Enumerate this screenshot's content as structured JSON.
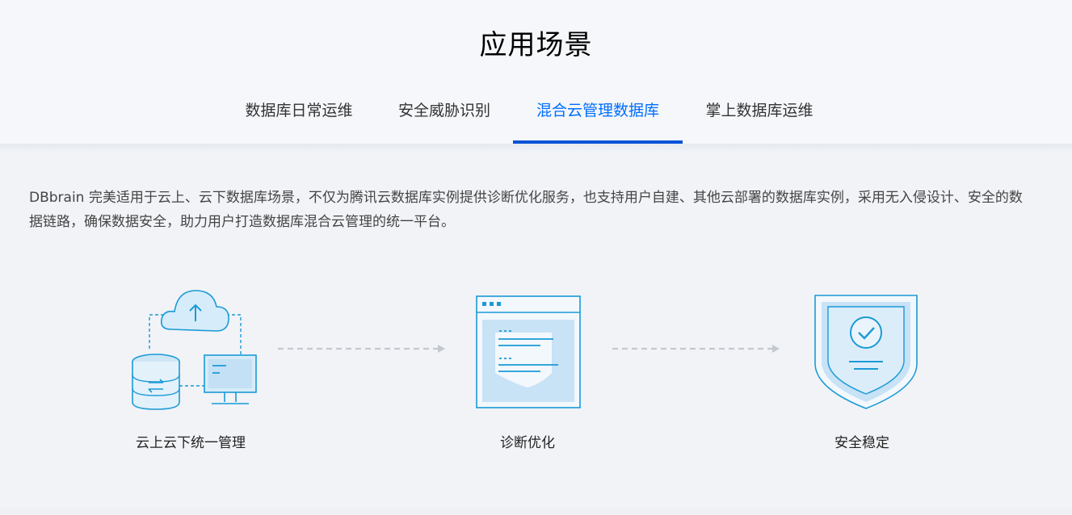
{
  "section": {
    "title": "应用场景"
  },
  "tabs": [
    {
      "label": "数据库日常运维",
      "active": false
    },
    {
      "label": "安全威胁识别",
      "active": false
    },
    {
      "label": "混合云管理数据库",
      "active": true
    },
    {
      "label": "掌上数据库运维",
      "active": false
    }
  ],
  "content": {
    "description": "DBbrain 完美适用于云上、云下数据库场景，不仅为腾讯云数据库实例提供诊断优化服务，也支持用户自建、其他云部署的数据库实例，采用无入侵设计、安全的数据链路，确保数据安全，助力用户打造数据库混合云管理的统一平台。",
    "flow": [
      {
        "label": "云上云下统一管理",
        "icon": "cloud-database-icon"
      },
      {
        "label": "诊断优化",
        "icon": "diagnosis-document-icon"
      },
      {
        "label": "安全稳定",
        "icon": "shield-check-icon"
      }
    ]
  },
  "colors": {
    "accent": "#006eff",
    "underline": "#0052d9",
    "icon_stroke": "#1a9ad6",
    "icon_fill": "#cfe6f7"
  }
}
